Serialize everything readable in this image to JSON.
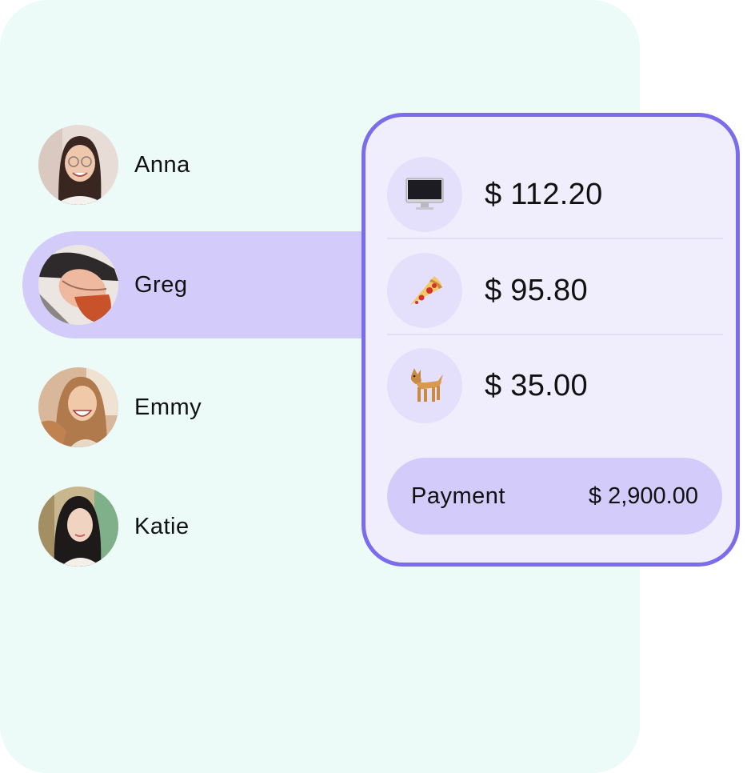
{
  "contacts": [
    {
      "name": "Anna",
      "avatar": "anna-avatar",
      "selected": false
    },
    {
      "name": "Greg",
      "avatar": "greg-avatar",
      "selected": true
    },
    {
      "name": "Emmy",
      "avatar": "emmy-avatar",
      "selected": false
    },
    {
      "name": "Katie",
      "avatar": "katie-avatar",
      "selected": false
    }
  ],
  "expenses": [
    {
      "icon": "computer-monitor-icon",
      "amount": "$ 112.20"
    },
    {
      "icon": "pizza-icon",
      "amount": "$ 95.80"
    },
    {
      "icon": "dog-icon",
      "amount": "$ 35.00"
    }
  ],
  "payment": {
    "label": "Payment",
    "total": "$ 2,900.00"
  },
  "colors": {
    "background_panel": "#ecfbf8",
    "card_background": "#f0eefd",
    "card_border": "#7b6cee",
    "highlight": "#d3cbfa",
    "icon_circle": "#e4e0fb"
  }
}
